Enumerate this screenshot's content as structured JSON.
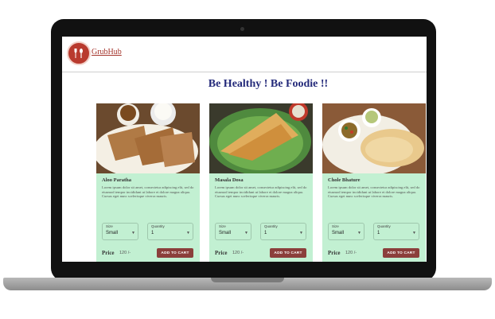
{
  "app": {
    "brand": "GrubHub",
    "tagline": "Be Healthy ! Be Foodie !!"
  },
  "ui": {
    "size_label": "Size",
    "quantity_label": "Quantity",
    "price_label": "Price",
    "add_to_cart_label": "ADD TO CART"
  },
  "products": [
    {
      "name": "Aloo Paratha",
      "description": "Lorem ipsum dolor sit amet, consectetur adipiscing elit, sed do eiusmod tempor incididunt ut labore et dolore magna aliqua. Cursus eget nunc scelerisque viverra mauris.",
      "size": "Small",
      "quantity": "1",
      "price": "120 /-"
    },
    {
      "name": "Masala Dosa",
      "description": "Lorem ipsum dolor sit amet, consectetur adipiscing elit, sed do eiusmod tempor incididunt ut labore et dolore magna aliqua. Cursus eget nunc scelerisque viverra mauris.",
      "size": "Small",
      "quantity": "1",
      "price": "120 /-"
    },
    {
      "name": "Chole Bhature",
      "description": "Lorem ipsum dolor sit amet, consectetur adipiscing elit, sed do eiusmod tempor incididunt ut labore et dolore magna aliqua. Cursus eget nunc scelerisque viverra mauris.",
      "size": "Small",
      "quantity": "1",
      "price": "120 /-"
    }
  ],
  "colors": {
    "brand_red": "#b93a2e",
    "tagline_navy": "#242a7a",
    "card_green": "#c2f0d2",
    "button_maroon": "#8b3f3b"
  },
  "icons": {
    "logo": "fork-spoon-icon",
    "select_caret": "caret-down-icon"
  }
}
